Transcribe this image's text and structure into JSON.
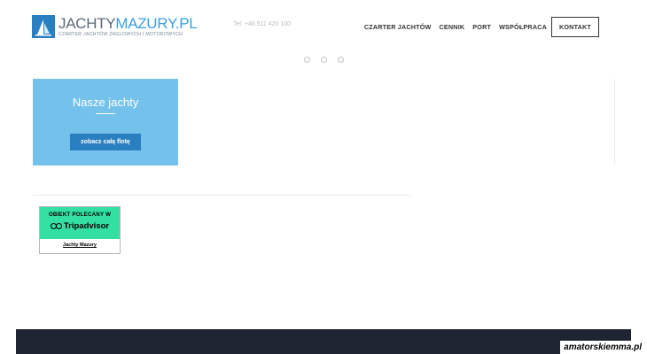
{
  "header": {
    "logo": {
      "title_part1": "JACHTY",
      "title_part2": "MAZURY.PL",
      "subtitle": "CZARTER JACHTÓW ŻAGLOWYCH I MOTOROWYCH"
    },
    "phone": "Tel: +48 511 420 100",
    "nav": [
      {
        "label": "CZARTER JACHTÓW"
      },
      {
        "label": "CENNIK"
      },
      {
        "label": "PORT"
      },
      {
        "label": "WSPÓŁPRACA"
      }
    ],
    "contact_button": "KONTAKT"
  },
  "slider": {
    "dot_count": 3
  },
  "card": {
    "title": "Nasze jachty",
    "button": "zobacz całą flotę",
    "bg_color": "#74c2ec",
    "button_color": "#2a7fc1"
  },
  "tripadvisor": {
    "heading": "OBIEKT POLECANY W",
    "brand": "Tripadvisor",
    "link": "Jachty Mazury",
    "color": "#34e0a1"
  },
  "watermark": "amatorskiemma.pl"
}
